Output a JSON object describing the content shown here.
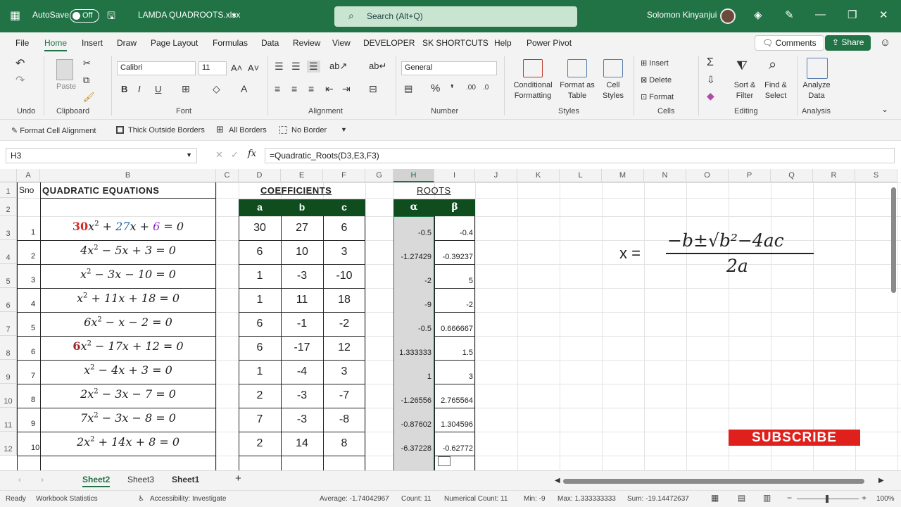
{
  "title_bar": {
    "autosave_label": "AutoSave",
    "autosave_state": "Off",
    "file_name": "LAMDA QUADROOTS.xlsx",
    "search_placeholder": "Search (Alt+Q)",
    "user_name": "Solomon Kinyanjui"
  },
  "menu": {
    "items": [
      "File",
      "Home",
      "Insert",
      "Draw",
      "Page Layout",
      "Formulas",
      "Data",
      "Review",
      "View",
      "DEVELOPER",
      "SK SHORTCUTS",
      "Help",
      "Power Pivot"
    ],
    "active": "Home",
    "comments_label": "Comments",
    "share_label": "Share"
  },
  "ribbon": {
    "groups": [
      "Undo",
      "Clipboard",
      "Font",
      "Alignment",
      "Number",
      "Styles",
      "Cells",
      "Editing",
      "Analysis"
    ],
    "font_name": "Calibri",
    "font_size": "11",
    "number_format": "General",
    "paste_label": "Paste",
    "conditional_formatting": [
      "Conditional",
      "Formatting"
    ],
    "format_as_table": [
      "Format as",
      "Table"
    ],
    "cell_styles": [
      "Cell",
      "Styles"
    ],
    "insert_label": "Insert",
    "delete_label": "Delete",
    "format_label": "Format",
    "sort_filter": [
      "Sort &",
      "Filter"
    ],
    "find_select": [
      "Find &",
      "Select"
    ],
    "analyze_data": [
      "Analyze",
      "Data"
    ]
  },
  "quick_bar": {
    "items": [
      "Format Cell Alignment",
      "Thick Outside Borders",
      "All Borders",
      "No Border"
    ]
  },
  "formula_bar": {
    "name_box": "H3",
    "formula": "=Quadratic_Roots(D3,E3,F3)"
  },
  "columns": [
    "A",
    "B",
    "C",
    "D",
    "E",
    "F",
    "G",
    "H",
    "I",
    "J",
    "K",
    "L",
    "M",
    "N",
    "O",
    "P",
    "Q",
    "R",
    "S"
  ],
  "selected_column": "H",
  "rows": [
    "1",
    "2",
    "3",
    "4",
    "5",
    "6",
    "7",
    "8",
    "9",
    "10",
    "11",
    "12"
  ],
  "sheet": {
    "a1": "Sno",
    "b1": "QUADRATIC EQUATIONS",
    "coef_title": "COEFFICIENTS",
    "roots_title": "ROOTS",
    "coef_headers": [
      "a",
      "b",
      "c"
    ],
    "root_headers": [
      "α",
      "β"
    ],
    "records": [
      {
        "sno": "1",
        "eq_html": "<span style='color:#d62828;font-weight:bold;font-style:normal'>30</span>x<sup>2</sup> + <span style='color:#1d5fa8'>27</span>x + <span style='color:#8a2bc2'>6</span> = 0",
        "a": "30",
        "b": "27",
        "c": "6",
        "alpha": "-0.5",
        "beta": "-0.4"
      },
      {
        "sno": "2",
        "eq_html": "4x<sup>2</sup> − 5x + 3 = 0",
        "a": "6",
        "b": "10",
        "c": "3",
        "alpha": "-1.27429",
        "beta": "-0.39237"
      },
      {
        "sno": "3",
        "eq_html": "x<sup>2</sup> − 3x − 10 = 0",
        "a": "1",
        "b": "-3",
        "c": "-10",
        "alpha": "-2",
        "beta": "5"
      },
      {
        "sno": "4",
        "eq_html": "x<sup>2</sup> + 11x + 18 = 0",
        "a": "1",
        "b": "11",
        "c": "18",
        "alpha": "-9",
        "beta": "-2"
      },
      {
        "sno": "5",
        "eq_html": "6x<sup>2</sup> − x − 2 = 0",
        "a": "6",
        "b": "-1",
        "c": "-2",
        "alpha": "-0.5",
        "beta": "0.666667"
      },
      {
        "sno": "6",
        "eq_html": "<span style='color:#a0282a;font-weight:bold;font-style:normal'>6</span>x<sup>2</sup> − 17x + 12 = 0",
        "a": "6",
        "b": "-17",
        "c": "12",
        "alpha": "1.333333",
        "beta": "1.5"
      },
      {
        "sno": "7",
        "eq_html": "x<sup>2</sup> − 4x + 3 = 0",
        "a": "1",
        "b": "-4",
        "c": "3",
        "alpha": "1",
        "beta": "3"
      },
      {
        "sno": "8",
        "eq_html": "2x<sup>2</sup> − 3x − 7 = 0",
        "a": "2",
        "b": "-3",
        "c": "-7",
        "alpha": "-1.26556",
        "beta": "2.765564"
      },
      {
        "sno": "9",
        "eq_html": "7x<sup>2</sup> − 3x − 8 = 0",
        "a": "7",
        "b": "-3",
        "c": "-8",
        "alpha": "-0.87602",
        "beta": "1.304596"
      },
      {
        "sno": "10",
        "eq_html": "2x<sup>2</sup> + 14x + 8 = 0",
        "a": "2",
        "b": "14",
        "c": "8",
        "alpha": "-6.37228",
        "beta": "-0.62772"
      }
    ]
  },
  "formula_image": {
    "lhs": "x =",
    "numerator": "−b±√b²−4ac",
    "denominator": "2a"
  },
  "subscribe_label": "SUBSCRIBE",
  "sheet_tabs": [
    "Sheet2",
    "Sheet3",
    "Sheet1"
  ],
  "active_sheet": "Sheet2",
  "status_bar": {
    "ready": "Ready",
    "workbook_statistics": "Workbook Statistics",
    "accessibility": "Accessibility: Investigate",
    "average": "Average: -1.74042967",
    "count": "Count: 11",
    "numerical_count": "Numerical Count: 11",
    "min": "Min: -9",
    "max": "Max: 1.333333333",
    "sum": "Sum: -19.14472637",
    "zoom": "100%"
  },
  "colors": {
    "brand": "#217346",
    "header_dark": "#0f4d1f",
    "subscribe": "#e0201c"
  }
}
